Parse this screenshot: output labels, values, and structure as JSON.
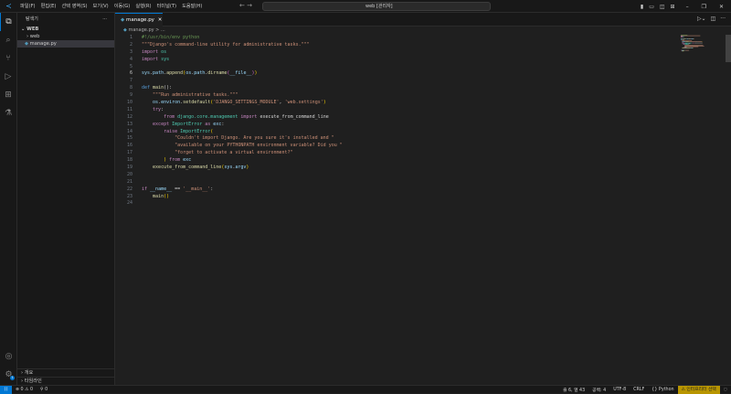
{
  "menu": [
    "파일(F)",
    "편집(E)",
    "선택 영역(S)",
    "보기(V)",
    "이동(G)",
    "실행(R)",
    "터미널(T)",
    "도움말(H)"
  ],
  "search": "web [관리자]",
  "sidebar": {
    "title": "탐색기",
    "root": "WEB",
    "items": [
      "web",
      "manage.py"
    ],
    "outline": "개요",
    "timeline": "타임라인"
  },
  "tab": {
    "label": "manage.py"
  },
  "breadcrumb": "manage.py > ...",
  "current_line": 6,
  "code": [
    [
      [
        "#!/usr/bin/env python",
        "c"
      ]
    ],
    [
      [
        "\"\"\"Django's command-line utility for administrative tasks.\"\"\"",
        "s"
      ]
    ],
    [
      [
        "import",
        "k"
      ],
      [
        " os",
        "t"
      ]
    ],
    [
      [
        "import",
        "k"
      ],
      [
        " sys",
        "t"
      ]
    ],
    [],
    [
      [
        "sys",
        "v"
      ],
      [
        ".",
        "p"
      ],
      [
        "path",
        "v"
      ],
      [
        ".",
        "p"
      ],
      [
        "append",
        "f"
      ],
      [
        "(",
        "b"
      ],
      [
        "os",
        "v"
      ],
      [
        ".",
        "p"
      ],
      [
        "path",
        "v"
      ],
      [
        ".",
        "p"
      ],
      [
        "dirname",
        "f"
      ],
      [
        "(",
        "b2"
      ],
      [
        "__file__",
        "v"
      ],
      [
        ")",
        "b2"
      ],
      [
        ")",
        "b"
      ]
    ],
    [],
    [
      [
        "def",
        "d"
      ],
      [
        " main",
        "f"
      ],
      [
        "():",
        "p"
      ]
    ],
    [
      [
        "    \"\"\"Run administrative tasks.\"\"\"",
        "s"
      ]
    ],
    [
      [
        "    os",
        "v"
      ],
      [
        ".",
        "p"
      ],
      [
        "environ",
        "v"
      ],
      [
        ".",
        "p"
      ],
      [
        "setdefault",
        "f"
      ],
      [
        "(",
        "b"
      ],
      [
        "'DJANGO_SETTINGS_MODULE'",
        "s"
      ],
      [
        ", ",
        "p"
      ],
      [
        "'web.settings'",
        "s"
      ],
      [
        ")",
        "b"
      ]
    ],
    [
      [
        "    try",
        "k"
      ],
      [
        ":",
        "p"
      ]
    ],
    [
      [
        "        from",
        "k"
      ],
      [
        " django.core.management",
        "t"
      ],
      [
        " import",
        "k"
      ],
      [
        " execute_from_command_line",
        "p"
      ]
    ],
    [
      [
        "    except",
        "k"
      ],
      [
        " ImportError",
        "t"
      ],
      [
        " as",
        "k"
      ],
      [
        " exc",
        "v"
      ],
      [
        ":",
        "p"
      ]
    ],
    [
      [
        "        raise",
        "k"
      ],
      [
        " ImportError",
        "t"
      ],
      [
        "(",
        "b"
      ]
    ],
    [
      [
        "            \"Couldn't import Django. Are you sure it's installed and \"",
        "s"
      ]
    ],
    [
      [
        "            \"available on your PYTHONPATH environment variable? Did you \"",
        "s"
      ]
    ],
    [
      [
        "            \"forget to activate a virtual environment?\"",
        "s"
      ]
    ],
    [
      [
        "        )",
        "b"
      ],
      [
        " from",
        "k"
      ],
      [
        " exc",
        "v"
      ]
    ],
    [
      [
        "    execute_from_command_line",
        "f"
      ],
      [
        "(",
        "b"
      ],
      [
        "sys",
        "v"
      ],
      [
        ".",
        "p"
      ],
      [
        "argv",
        "v"
      ],
      [
        ")",
        "b"
      ]
    ],
    [],
    [],
    [
      [
        "if",
        "k"
      ],
      [
        " __name__",
        "v"
      ],
      [
        " == ",
        "p"
      ],
      [
        "'__main__'",
        "s"
      ],
      [
        ":",
        "p"
      ]
    ],
    [
      [
        "    main",
        "f"
      ],
      [
        "()",
        "b"
      ]
    ],
    []
  ],
  "status": {
    "errors": "0",
    "warnings": "0",
    "ports": "0",
    "position": "줄 6, 열 43",
    "spaces": "공백: 4",
    "encoding": "UTF-8",
    "eol": "CRLF",
    "language": "{} Python",
    "interpreter": "⚠ 인터프리터 선택",
    "settings_badge": "1"
  }
}
